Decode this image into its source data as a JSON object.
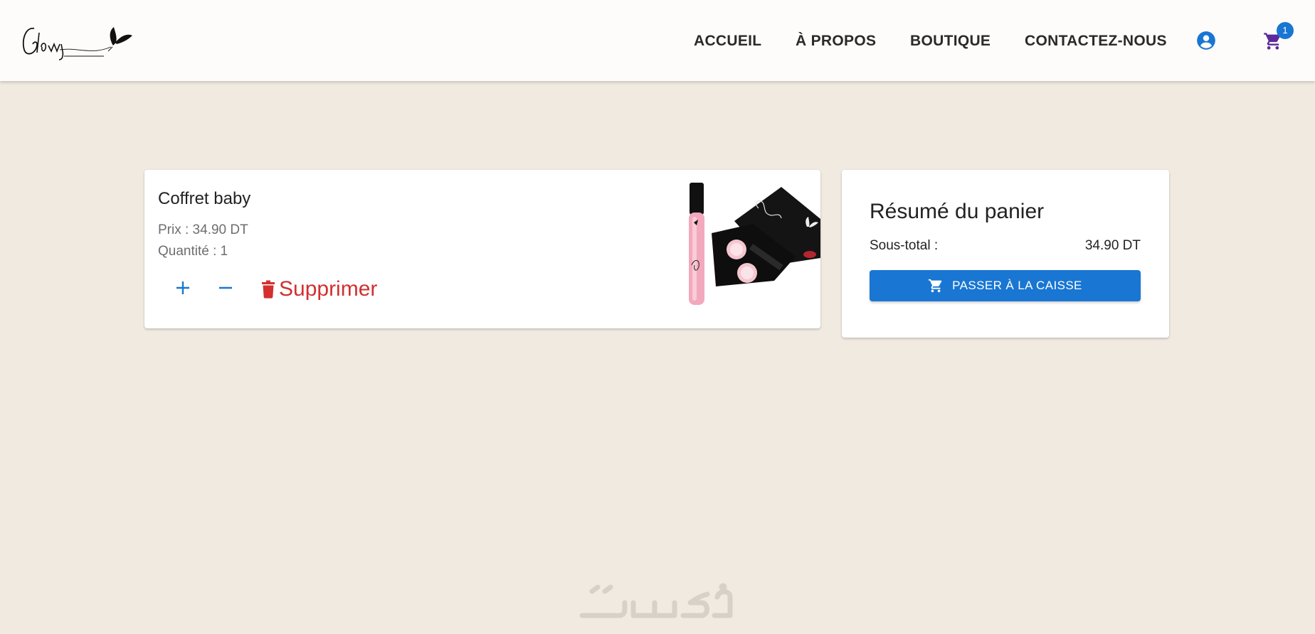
{
  "header": {
    "nav": [
      {
        "id": "accueil",
        "label": "ACCUEIL"
      },
      {
        "id": "apropos",
        "label": "À PROPOS"
      },
      {
        "id": "boutique",
        "label": "BOUTIQUE"
      },
      {
        "id": "contact",
        "label": "CONTACTEZ-NOUS"
      }
    ],
    "account_icon": "account-circle-icon",
    "cart_icon": "shopping-cart-icon",
    "cart_count": "1",
    "accent_color": "#1976d2",
    "cart_icon_color": "#5b2a9b"
  },
  "cart": {
    "items": [
      {
        "name": "Coffret baby",
        "price_text": "Prix : 34.90 DT",
        "quantity_text": "Quantité : 1",
        "increment_icon": "plus-icon",
        "decrement_icon": "minus-icon",
        "delete_icon": "trash-icon",
        "delete_label": "Supprimer",
        "delete_color": "#d32f2f"
      }
    ]
  },
  "summary": {
    "title": "Résumé du panier",
    "subtotal_label": "Sous-total :",
    "subtotal_value": "34.90 DT",
    "checkout_icon": "shopping-cart-icon",
    "checkout_label": "PASSER À LA CAISSE"
  },
  "colors": {
    "page_background": "#f0eae1",
    "header_background": "#fdfcfa",
    "primary": "#1976d2",
    "danger": "#d32f2f"
  }
}
